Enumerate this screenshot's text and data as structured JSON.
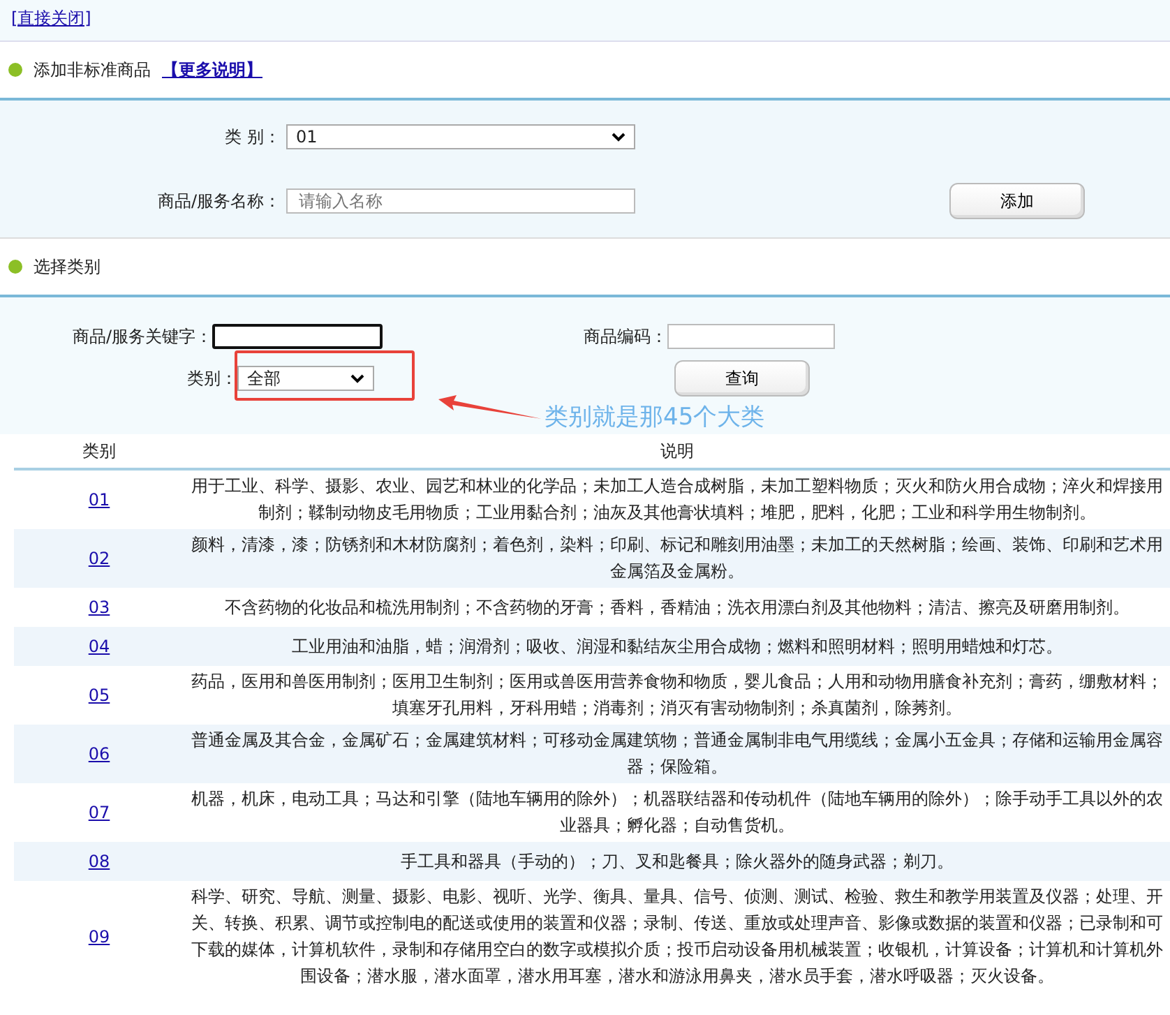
{
  "close_link": "[直接关闭]",
  "add_section": {
    "title": "添加非标准商品",
    "more_link": "【更多说明】"
  },
  "add_form": {
    "category_label": "类 别：",
    "category_value": "01",
    "name_label": "商品/服务名称：",
    "name_placeholder": "请输入名称",
    "add_button": "添加"
  },
  "select_section": {
    "title": "选择类别"
  },
  "search": {
    "keyword_label": "商品/服务关键字：",
    "keyword_focused": true,
    "code_label": "商品编码：",
    "category_label": "类别：",
    "category_value": "全部",
    "query_button": "查询"
  },
  "annotation": {
    "text": "类别就是那45个大类"
  },
  "table": {
    "columns": [
      "类别",
      "说明"
    ],
    "rows": [
      {
        "code": "01",
        "description": "用于工业、科学、摄影、农业、园艺和林业的化学品；未加工人造合成树脂，未加工塑料物质；灭火和防火用合成物；淬火和焊接用制剂；鞣制动物皮毛用物质；工业用黏合剂；油灰及其他膏状填料；堆肥，肥料，化肥；工业和科学用生物制剂。"
      },
      {
        "code": "02",
        "description": "颜料，清漆，漆；防锈剂和木材防腐剂；着色剂，染料；印刷、标记和雕刻用油墨；未加工的天然树脂；绘画、装饰、印刷和艺术用金属箔及金属粉。"
      },
      {
        "code": "03",
        "description": "不含药物的化妆品和梳洗用制剂；不含药物的牙膏；香料，香精油；洗衣用漂白剂及其他物料；清洁、擦亮及研磨用制剂。"
      },
      {
        "code": "04",
        "description": "工业用油和油脂，蜡；润滑剂；吸收、润湿和黏结灰尘用合成物；燃料和照明材料；照明用蜡烛和灯芯。"
      },
      {
        "code": "05",
        "description": "药品，医用和兽医用制剂；医用卫生制剂；医用或兽医用营养食物和物质，婴儿食品；人用和动物用膳食补充剂；膏药，绷敷材料；填塞牙孔用料，牙科用蜡；消毒剂；消灭有害动物制剂；杀真菌剂，除莠剂。"
      },
      {
        "code": "06",
        "description": "普通金属及其合金，金属矿石；金属建筑材料；可移动金属建筑物；普通金属制非电气用缆线；金属小五金具；存储和运输用金属容器；保险箱。"
      },
      {
        "code": "07",
        "description": "机器，机床，电动工具；马达和引擎（陆地车辆用的除外）；机器联结器和传动机件（陆地车辆用的除外）；除手动手工具以外的农业器具；孵化器；自动售货机。"
      },
      {
        "code": "08",
        "description": "手工具和器具（手动的）；刀、叉和匙餐具；除火器外的随身武器；剃刀。"
      },
      {
        "code": "09",
        "description": "科学、研究、导航、测量、摄影、电影、视听、光学、衡具、量具、信号、侦测、测试、检验、救生和教学用装置及仪器；处理、开关、转换、积累、调节或控制电的配送或使用的装置和仪器；录制、传送、重放或处理声音、影像或数据的装置和仪器；已录制和可下载的媒体，计算机软件，录制和存储用空白的数字或模拟介质；投币启动设备用机械装置；收银机，计算设备；计算机和计算机外围设备；潜水服，潜水面罩，潜水用耳塞，潜水和游泳用鼻夹，潜水员手套，潜水呼吸器；灭火设备。"
      }
    ]
  }
}
